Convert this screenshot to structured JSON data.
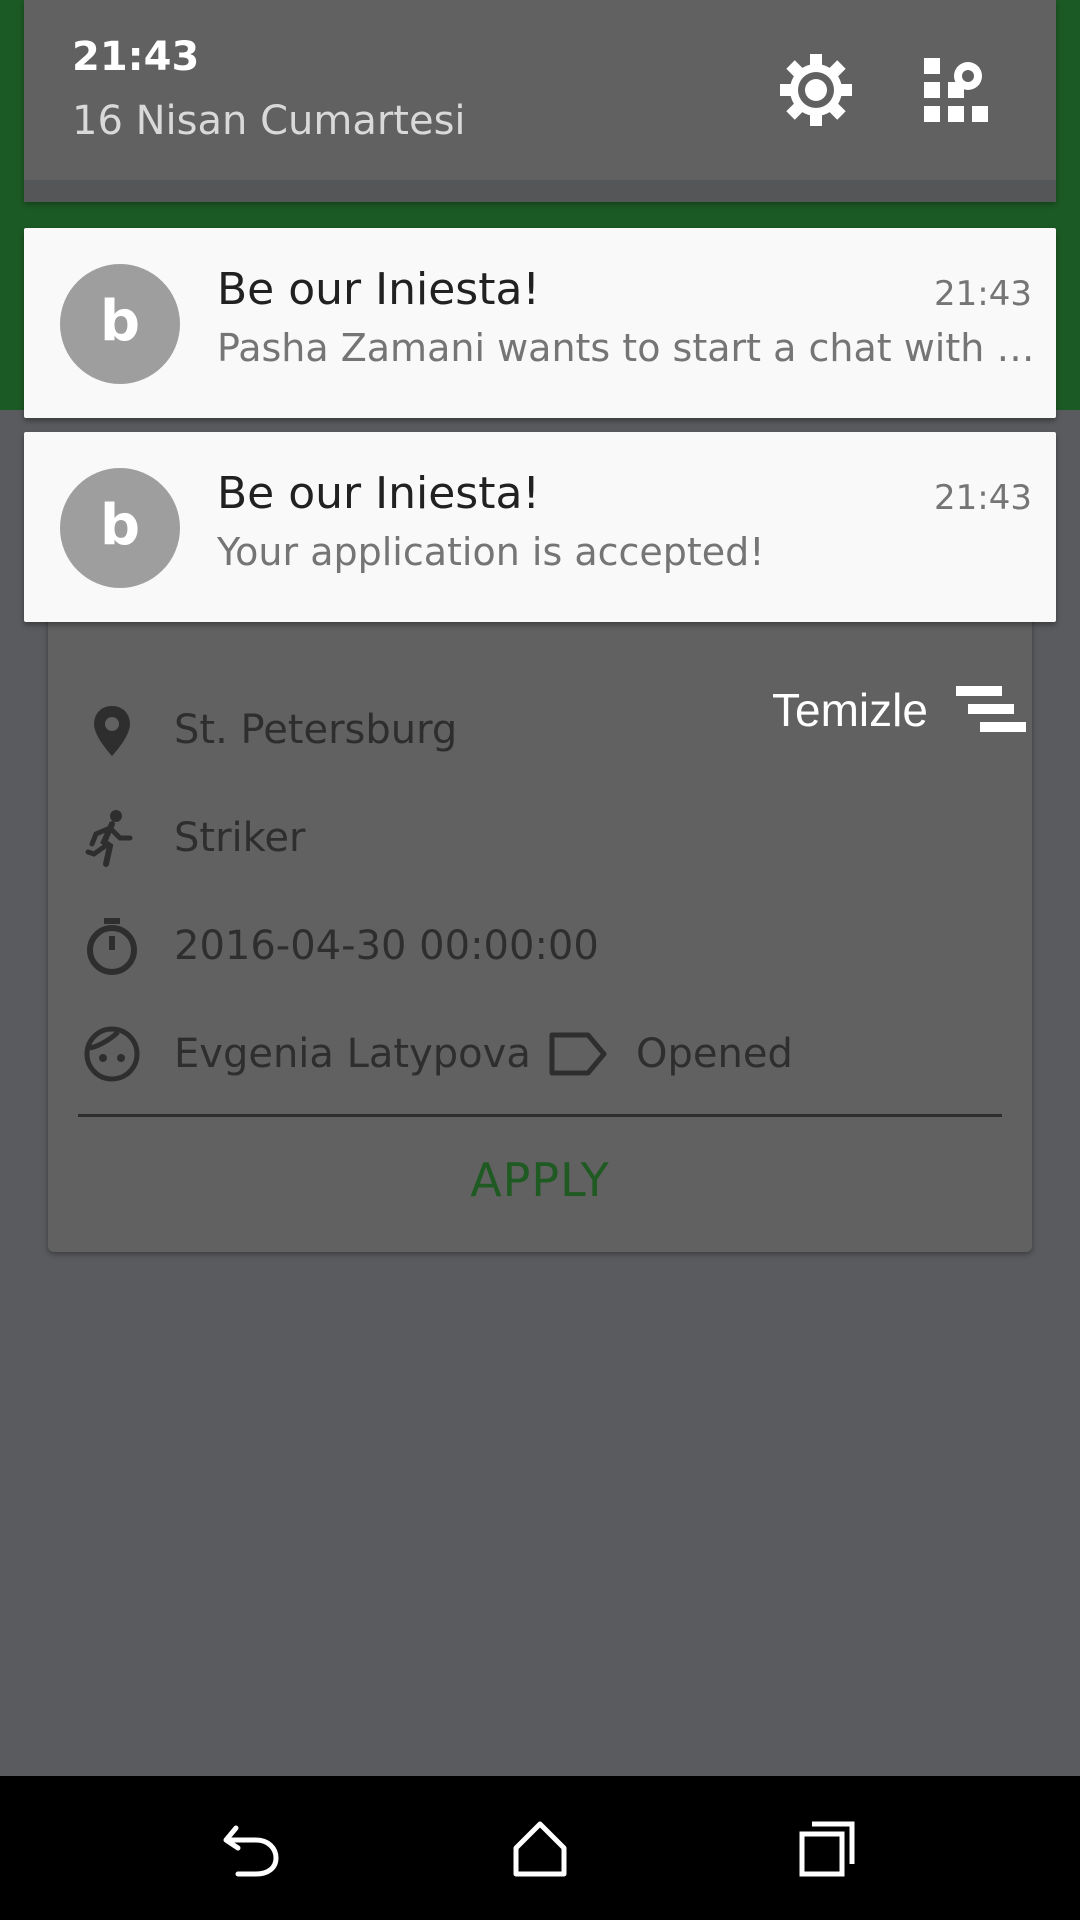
{
  "shade": {
    "time": "21:43",
    "date": "16 Nisan Cumartesi",
    "icons": {
      "settings": "gear-icon",
      "quick_settings": "quick-settings-icon"
    }
  },
  "notifications": [
    {
      "avatar_letter": "b",
      "title": "Be our Iniesta!",
      "time": "21:43",
      "body": "Pasha Zamani wants to start a chat with y.."
    },
    {
      "avatar_letter": "b",
      "title": "Be our Iniesta!",
      "time": "21:43",
      "body": "Your application is accepted!"
    }
  ],
  "clear_all": {
    "label": "Temizle",
    "icon": "clear-all-icon"
  },
  "card": {
    "location": "St. Petersburg",
    "position": "Striker",
    "datetime": "2016-04-30 00:00:00",
    "owner": "Evgenia Latypova",
    "status": "Opened",
    "apply_label": "APPLY"
  },
  "colors": {
    "app_green": "#1c5a25",
    "apply_green": "#1e5a22",
    "scrim": "#5a5b5e",
    "avatar": "#9e9e9e"
  },
  "navbar": {
    "icons": [
      "back-icon",
      "home-icon",
      "recents-icon"
    ]
  }
}
